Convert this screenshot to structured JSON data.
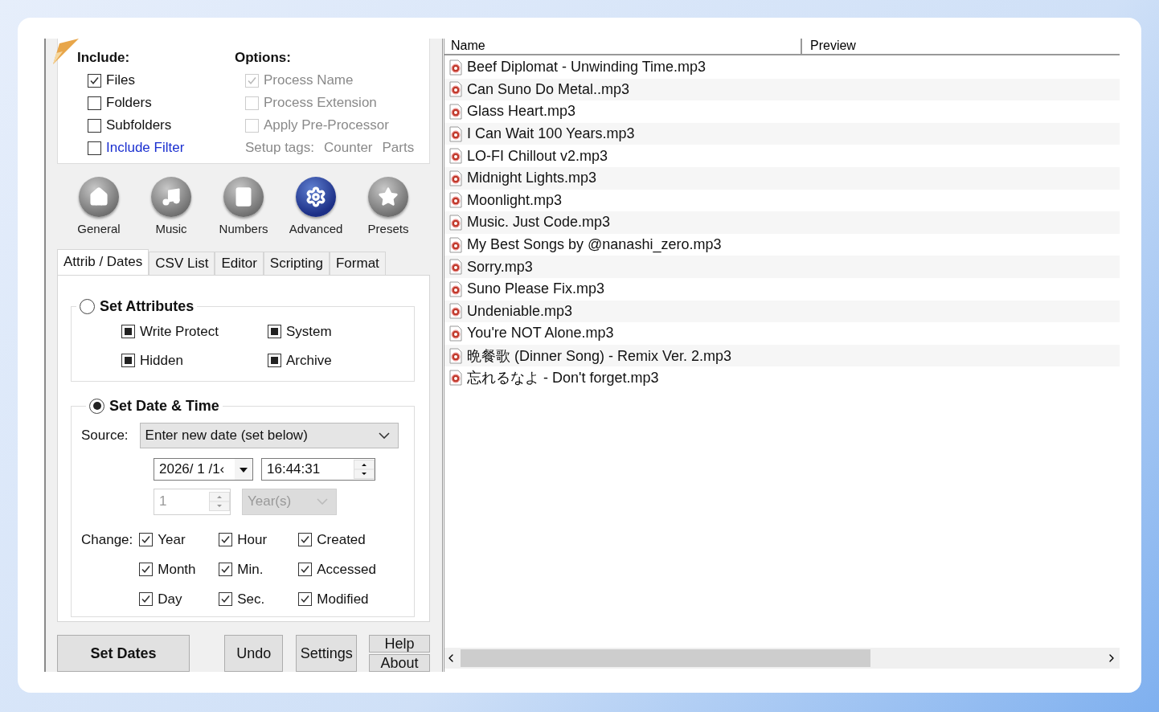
{
  "include": {
    "title": "Include:",
    "items": [
      {
        "label": "Files",
        "checked": true,
        "kind": "plain"
      },
      {
        "label": "Folders",
        "checked": false,
        "kind": "plain"
      },
      {
        "label": "Subfolders",
        "checked": false,
        "kind": "plain"
      },
      {
        "label": "Include Filter",
        "checked": false,
        "kind": "link"
      }
    ]
  },
  "options": {
    "title": "Options:",
    "items": [
      {
        "label": "Process Name",
        "checked": true,
        "disabled": true
      },
      {
        "label": "Process Extension",
        "checked": false,
        "disabled": true
      },
      {
        "label": "Apply Pre-Processor",
        "checked": false,
        "disabled": true
      }
    ],
    "setup_tags": {
      "label": "Setup tags:",
      "links": [
        "Counter",
        "Parts"
      ]
    }
  },
  "nav": [
    {
      "label": "General",
      "selected": false
    },
    {
      "label": "Music",
      "selected": false
    },
    {
      "label": "Numbers",
      "selected": false
    },
    {
      "label": "Advanced",
      "selected": true
    },
    {
      "label": "Presets",
      "selected": false
    }
  ],
  "tabs": [
    {
      "label": "Attrib / Dates",
      "selected": true
    },
    {
      "label": "CSV List",
      "selected": false
    },
    {
      "label": "Editor",
      "selected": false
    },
    {
      "label": "Scripting",
      "selected": false
    },
    {
      "label": "Format",
      "selected": false
    }
  ],
  "attributes": {
    "title": "Set Attributes",
    "selected": false,
    "items": [
      {
        "label": "Write Protect",
        "indeterminate": true
      },
      {
        "label": "System",
        "indeterminate": true
      },
      {
        "label": "Hidden",
        "indeterminate": true
      },
      {
        "label": "Archive",
        "indeterminate": true
      }
    ]
  },
  "date_time": {
    "title": "Set Date & Time",
    "selected": true,
    "source_label": "Source:",
    "source_value": "Enter new date (set below)",
    "date": "2026/ 1 /1‹",
    "time": "16:44:31",
    "offset_value": "1",
    "offset_unit": "Year(s)",
    "change_label": "Change:",
    "change_items": [
      {
        "label": "Year",
        "checked": true
      },
      {
        "label": "Hour",
        "checked": true
      },
      {
        "label": "Created",
        "checked": true
      },
      {
        "label": "Month",
        "checked": true
      },
      {
        "label": "Min.",
        "checked": true
      },
      {
        "label": "Accessed",
        "checked": true
      },
      {
        "label": "Day",
        "checked": true
      },
      {
        "label": "Sec.",
        "checked": true
      },
      {
        "label": "Modified",
        "checked": true
      }
    ]
  },
  "buttons": {
    "primary": "Set Dates",
    "undo": "Undo",
    "settings": "Settings",
    "help": "Help",
    "about": "About"
  },
  "file_list": {
    "columns": [
      "Name",
      "Preview"
    ],
    "rows": [
      {
        "name": "Beef Diplomat - Unwinding Time.mp3"
      },
      {
        "name": "Can Suno Do Metal..mp3"
      },
      {
        "name": "Glass Heart.mp3"
      },
      {
        "name": "I Can Wait 100 Years.mp3"
      },
      {
        "name": "LO-FI Chillout v2.mp3"
      },
      {
        "name": "Midnight Lights.mp3"
      },
      {
        "name": "Moonlight.mp3"
      },
      {
        "name": "Music. Just Code.mp3"
      },
      {
        "name": "My Best Songs by @nanashi_zero.mp3"
      },
      {
        "name": "Sorry.mp3"
      },
      {
        "name": "Suno Please Fix.mp3"
      },
      {
        "name": "Undeniable.mp3"
      },
      {
        "name": "You're NOT Alone.mp3"
      },
      {
        "name": "晩餐歌 (Dinner Song) - Remix Ver. 2.mp3"
      },
      {
        "name": "忘れるなよ - Don't forget.mp3"
      }
    ]
  }
}
